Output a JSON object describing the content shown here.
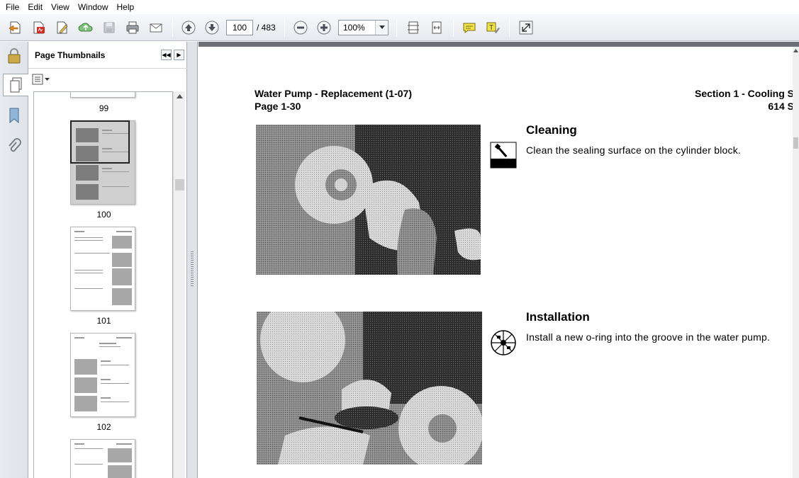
{
  "menu": [
    "File",
    "Edit",
    "View",
    "Window",
    "Help"
  ],
  "toolbar": {
    "current_page": "100",
    "total_pages": "/ 483",
    "zoom": "100%"
  },
  "sidebar": {
    "title": "Page Thumbnails"
  },
  "thumbnails": [
    {
      "label": "99"
    },
    {
      "label": "100"
    },
    {
      "label": "101"
    },
    {
      "label": "102"
    }
  ],
  "document": {
    "header_left_line1": "Water Pump - Replacement (1-07)",
    "header_left_line2": "Page 1-30",
    "header_right_line1": "Section 1 - Cooling S",
    "header_right_line2": "614 S",
    "step1": {
      "heading": "Cleaning",
      "text": "Clean the sealing surface on the cylinder block."
    },
    "step2": {
      "heading": "Installation",
      "text": "Install a new o-ring into the groove in the water pump."
    }
  }
}
